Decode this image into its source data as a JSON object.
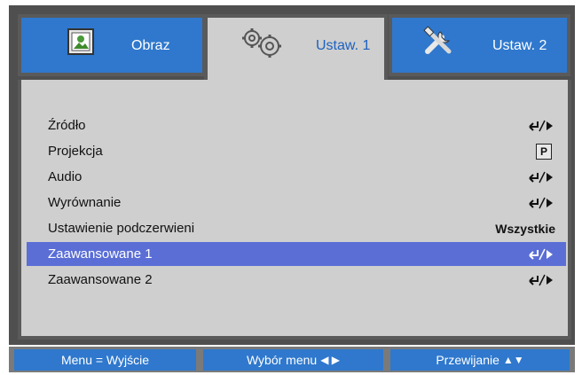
{
  "tabs": [
    {
      "label": "Obraz",
      "icon": "picture-icon",
      "active": false
    },
    {
      "label": "Ustaw. 1",
      "icon": "gears-icon",
      "active": true
    },
    {
      "label": "Ustaw. 2",
      "icon": "tools-icon",
      "active": false
    }
  ],
  "menu": {
    "items": [
      {
        "label": "Źródło",
        "value": "",
        "icon": "enter-arrow-icon"
      },
      {
        "label": "Projekcja",
        "value": "P",
        "icon": "projection-icon"
      },
      {
        "label": "Audio",
        "value": "",
        "icon": "enter-arrow-icon"
      },
      {
        "label": "Wyrównanie",
        "value": "",
        "icon": "enter-arrow-icon"
      },
      {
        "label": "Ustawienie podczerwieni",
        "value": "Wszystkie",
        "icon": ""
      },
      {
        "label": "Zaawansowane 1",
        "value": "",
        "icon": "enter-arrow-icon",
        "selected": true
      },
      {
        "label": "Zaawansowane 2",
        "value": "",
        "icon": "enter-arrow-icon"
      }
    ]
  },
  "bottom_bar": {
    "menu_exit": "Menu = Wyjście",
    "menu_select": "Wybór menu",
    "menu_select_glyphs": "◀ ▶",
    "scroll": "Przewijanie",
    "scroll_glyphs": "▲▼"
  },
  "colors": {
    "tab_blue": "#2f78cd",
    "panel_gray": "#cfcfcf",
    "selected_row": "#5a6ed6",
    "frame_dark": "#4f4f4f"
  }
}
